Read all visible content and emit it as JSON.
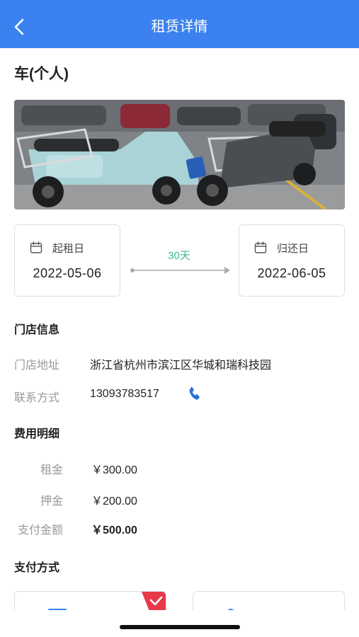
{
  "header": {
    "title": "租赁详情"
  },
  "vehicle": {
    "title": "车(个人)"
  },
  "rental": {
    "start_label": "起租日",
    "start_date": "2022-05-06",
    "duration": "30天",
    "end_label": "归还日",
    "end_date": "2022-06-05"
  },
  "store": {
    "section_title": "门店信息",
    "address_label": "门店地址",
    "address_value": "浙江省杭州市滨江区华城和瑞科技园",
    "contact_label": "联系方式",
    "contact_value": "13093783517"
  },
  "fees": {
    "section_title": "费用明细",
    "rent_label": "租金",
    "rent_value": "￥300.00",
    "deposit_label": "押金",
    "deposit_value": "￥200.00",
    "total_label": "支付金额",
    "total_value": "￥500.00"
  },
  "payment": {
    "section_title": "支付方式"
  },
  "colors": {
    "primary": "#3b82f0",
    "duration_green": "#3dbb8b",
    "selected_badge": "#e8394a"
  }
}
